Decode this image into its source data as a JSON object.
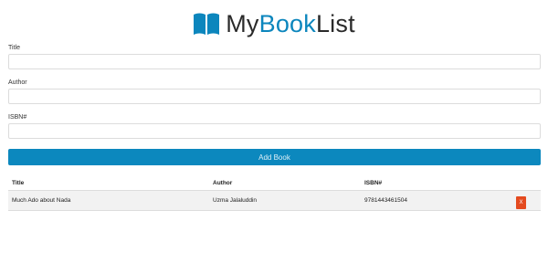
{
  "brand": {
    "part1": "My",
    "part2": "Book",
    "part3": "List",
    "colors": {
      "accent": "#0c86bd",
      "text": "#2a2a2a"
    },
    "icon": "open-book-icon"
  },
  "form": {
    "title_label": "Title",
    "title_value": "",
    "author_label": "Author",
    "author_value": "",
    "isbn_label": "ISBN#",
    "isbn_value": "",
    "submit_label": "Add Book",
    "submit_color": "#0c88be"
  },
  "table": {
    "headers": [
      "Title",
      "Author",
      "ISBN#"
    ],
    "rows": [
      {
        "title": "Much Ado about Nada",
        "author": "Uzma Jalaluddin",
        "isbn": "9781443461504",
        "delete_label": "X"
      }
    ],
    "delete_color": "#e44a1f"
  }
}
